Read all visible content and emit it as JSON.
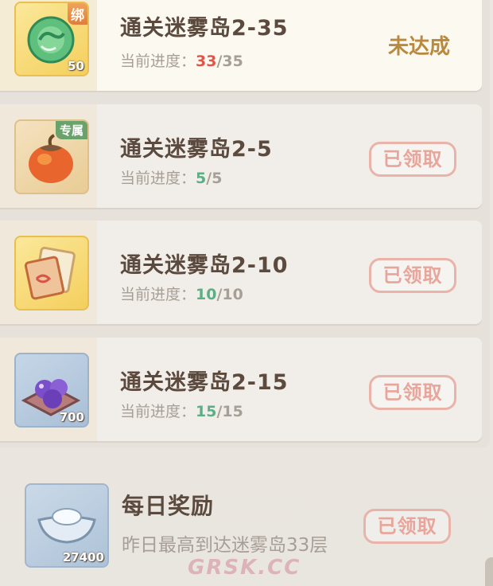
{
  "tasks": [
    {
      "title": "通关迷雾岛2-35",
      "progress_label": "当前进度：",
      "current": "33",
      "total": "/35",
      "status": "未达成",
      "reward": {
        "tag": "绑",
        "qty": "50",
        "icon": "jade-cloud-icon"
      }
    },
    {
      "title": "通关迷雾岛2-5",
      "progress_label": "当前进度：",
      "current": "5",
      "total": "/5",
      "status": "已领取",
      "reward": {
        "tag": "专属",
        "qty": "",
        "icon": "fruit-icon"
      }
    },
    {
      "title": "通关迷雾岛2-10",
      "progress_label": "当前进度：",
      "current": "10",
      "total": "/10",
      "status": "已领取",
      "reward": {
        "tag": "",
        "qty": "",
        "icon": "scroll-icon"
      }
    },
    {
      "title": "通关迷雾岛2-15",
      "progress_label": "当前进度：",
      "current": "15",
      "total": "/15",
      "status": "已领取",
      "reward": {
        "tag": "",
        "qty": "700",
        "icon": "purple-orbs-icon"
      }
    }
  ],
  "daily": {
    "title": "每日奖励",
    "desc": "昨日最高到达迷雾岛33层",
    "status": "已领取",
    "reward": {
      "qty": "27400",
      "icon": "silver-ingot-icon"
    }
  },
  "watermark": "GRSK.CC",
  "colors": {
    "progress_incomplete": "#e2564a",
    "progress_complete": "#5bae86",
    "status_pending": "#b8893e",
    "claimed_button": "#e8a59b"
  }
}
